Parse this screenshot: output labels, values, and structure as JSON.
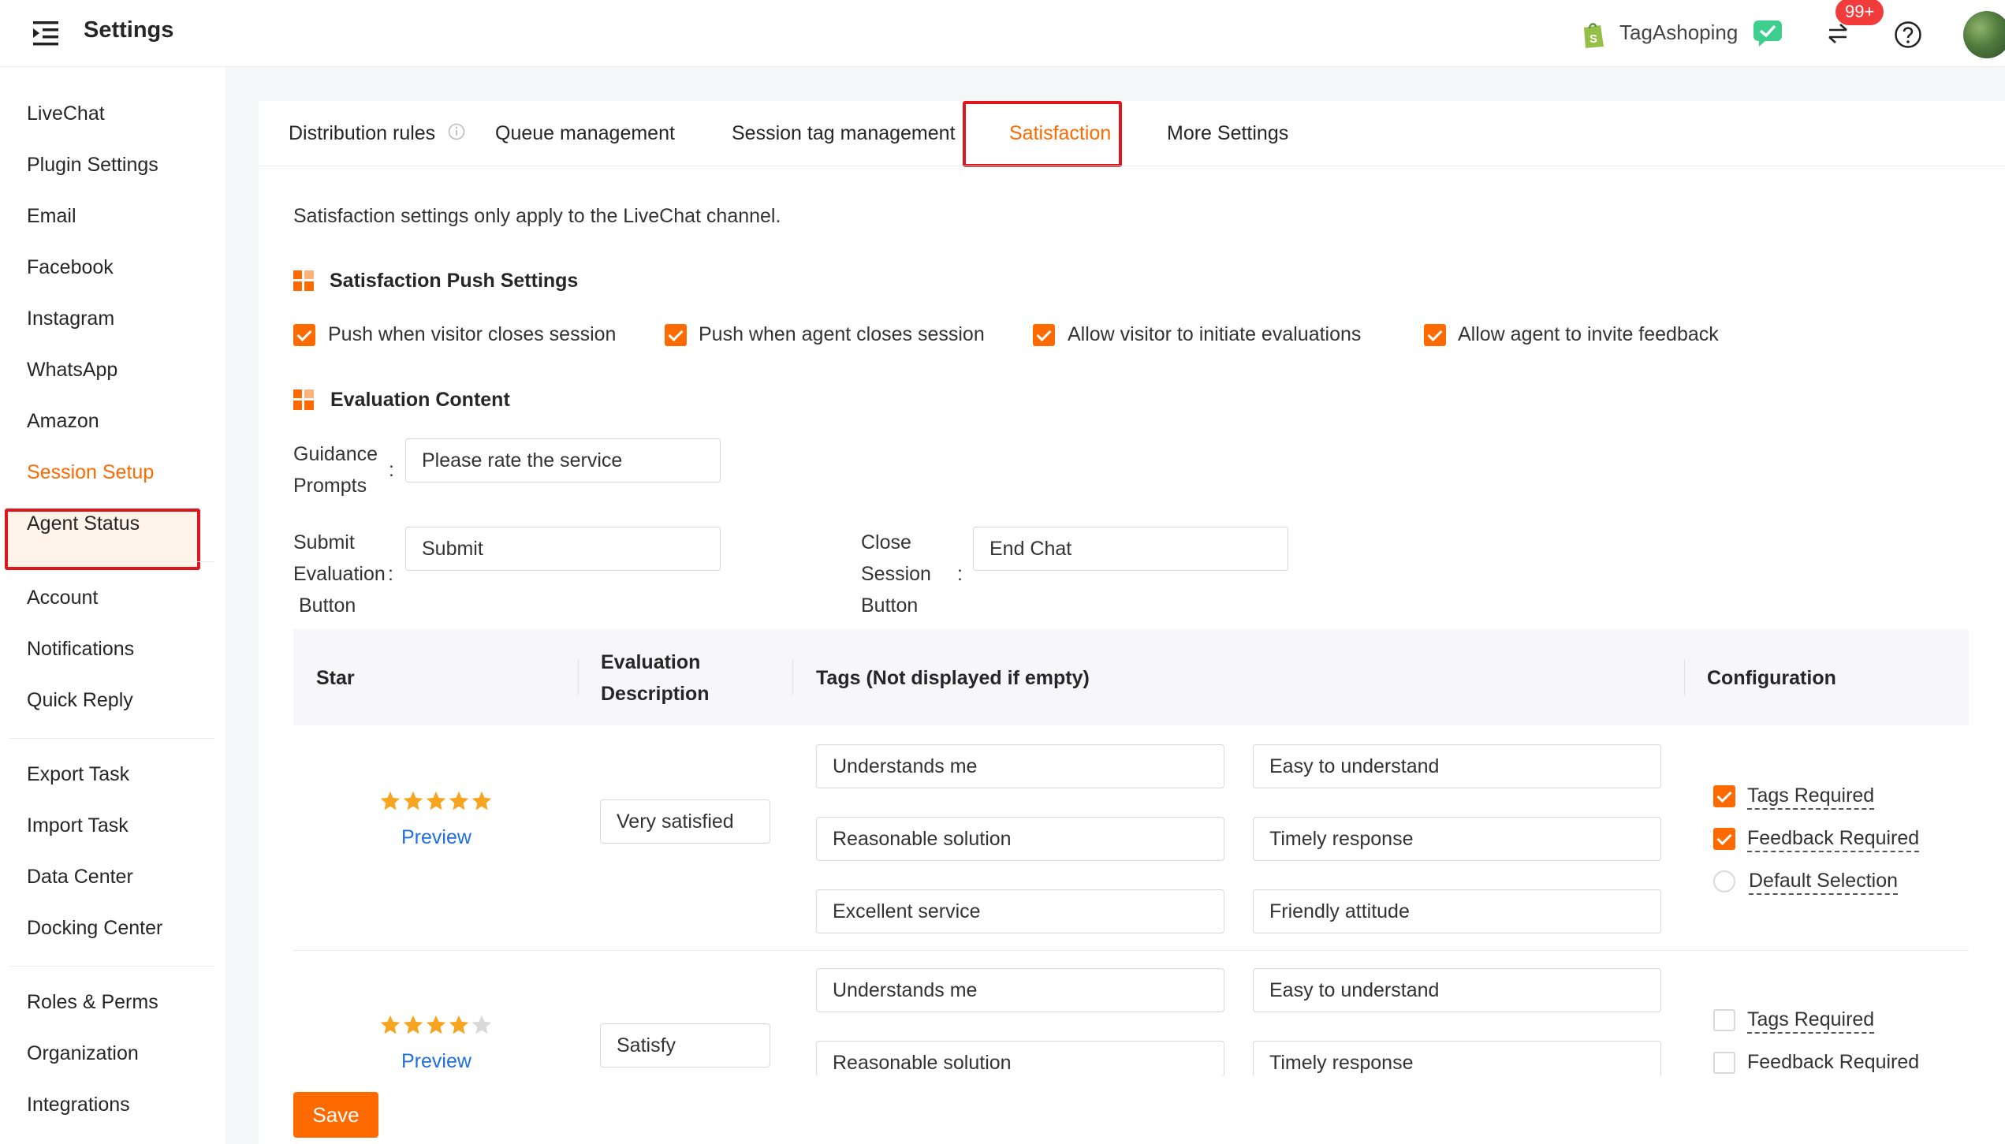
{
  "header": {
    "title": "Settings",
    "shop_name": "TagAshoping",
    "notification_count": "99+"
  },
  "sidebar": {
    "groups": [
      [
        "LiveChat",
        "Plugin Settings",
        "Email",
        "Facebook",
        "Instagram",
        "WhatsApp",
        "Amazon",
        "Session Setup",
        "Agent Status"
      ],
      [
        "Account",
        "Notifications",
        "Quick Reply"
      ],
      [
        "Export Task",
        "Import Task",
        "Data Center",
        "Docking Center"
      ],
      [
        "Roles & Perms",
        "Organization",
        "Integrations"
      ]
    ],
    "active": "Session Setup"
  },
  "tabs": {
    "items": [
      "Distribution rules",
      "Queue management",
      "Session tag management",
      "Satisfaction",
      "More Settings"
    ],
    "active": "Satisfaction"
  },
  "note": "Satisfaction settings only apply to the LiveChat channel.",
  "push_settings": {
    "title": "Satisfaction Push Settings",
    "options": [
      {
        "label": "Push when visitor closes session",
        "checked": true
      },
      {
        "label": "Push when agent closes session",
        "checked": true
      },
      {
        "label": "Allow visitor to initiate evaluations",
        "checked": true
      },
      {
        "label": "Allow agent to invite feedback",
        "checked": true
      }
    ]
  },
  "evaluation": {
    "title": "Evaluation Content",
    "guidance_label_1": "Guidance",
    "guidance_label_2": "Prompts",
    "guidance_value": "Please rate the service",
    "submit_label_1": "Submit",
    "submit_label_2": "Evaluation",
    "submit_label_3": "Button",
    "submit_value": "Submit",
    "close_label_1": "Close",
    "close_label_2": "Session",
    "close_label_3": "Button",
    "close_value": "End Chat",
    "colon": ":"
  },
  "table": {
    "headers": {
      "star": "Star",
      "desc_1": "Evaluation",
      "desc_2": "Description",
      "tags": "Tags (Not displayed if empty)",
      "config": "Configuration"
    },
    "rows": [
      {
        "stars": 5,
        "preview": "Preview",
        "description": "Very satisfied",
        "tags": [
          "Understands me",
          "Easy to understand",
          "Reasonable solution",
          "Timely response",
          "Excellent service",
          "Friendly attitude"
        ],
        "tags_required": {
          "label": "Tags Required",
          "checked": true
        },
        "feedback_required": {
          "label": "Feedback Required",
          "checked": true
        },
        "default_selection": {
          "label": "Default Selection",
          "selected": false
        }
      },
      {
        "stars": 4,
        "preview": "Preview",
        "description": "Satisfy",
        "tags": [
          "Understands me",
          "Easy to understand",
          "Reasonable solution",
          "Timely response"
        ],
        "tags_required": {
          "label": "Tags Required",
          "checked": false
        },
        "feedback_required": {
          "label": "Feedback Required",
          "checked": false
        }
      }
    ]
  },
  "save_label": "Save",
  "colors": {
    "accent": "#ff6a00",
    "highlight": "#e0161f",
    "link": "#1f6fde",
    "star": "#f7a520"
  }
}
